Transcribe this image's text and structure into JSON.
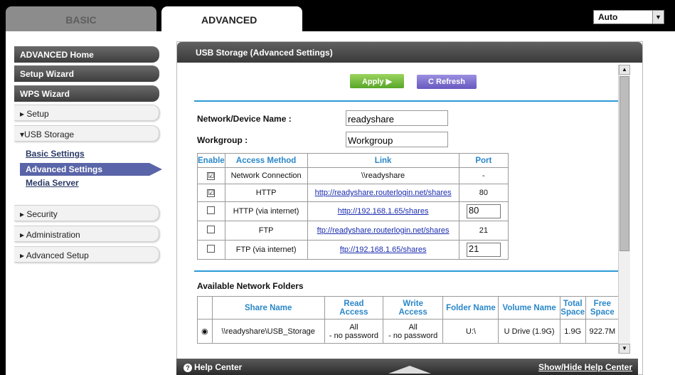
{
  "tabs": {
    "basic": "BASIC",
    "advanced": "ADVANCED"
  },
  "language": {
    "selected": "Auto"
  },
  "sidebar": {
    "advanced_home": "ADVANCED Home",
    "setup_wizard": "Setup Wizard",
    "wps_wizard": "WPS Wizard",
    "setup": "▸ Setup",
    "usb_storage": "▾USB Storage",
    "basic_settings": "Basic Settings",
    "advanced_settings": "Advanced Settings",
    "media_server": "Media Server",
    "security": "▸ Security",
    "administration": "▸ Administration",
    "advanced_setup": "▸ Advanced Setup"
  },
  "panel": {
    "title": "USB Storage (Advanced Settings)",
    "apply": "Apply ▶",
    "refresh": "C  Refresh",
    "device_name_label": "Network/Device Name :",
    "device_name_value": "readyshare",
    "workgroup_label": "Workgroup :",
    "workgroup_value": "Workgroup"
  },
  "access_table": {
    "headers": [
      "Enable",
      "Access Method",
      "Link",
      "Port"
    ],
    "rows": [
      {
        "enabled": "☑",
        "method": "Network Connection",
        "link": "\\\\readyshare",
        "port": "-"
      },
      {
        "enabled": "☑",
        "method": "HTTP",
        "link": "http://readyshare.routerlogin.net/shares",
        "port": "80"
      },
      {
        "enabled": "",
        "method": "HTTP (via internet)",
        "link": "http://192.168.1.65/shares",
        "port": "80"
      },
      {
        "enabled": "",
        "method": "FTP",
        "link": "ftp://readyshare.routerlogin.net/shares",
        "port": "21"
      },
      {
        "enabled": "",
        "method": "FTP (via internet)",
        "link": "ftp://192.168.1.65/shares",
        "port": "21"
      }
    ]
  },
  "folders": {
    "title": "Available Network Folders",
    "headers": {
      "share_name": "Share Name",
      "read_access_1": "Read",
      "read_access_2": "Access",
      "write_access_1": "Write",
      "write_access_2": "Access",
      "folder_name": "Folder Name",
      "volume_name": "Volume Name",
      "total_1": "Total",
      "total_2": "Space",
      "free_1": "Free",
      "free_2": "Space"
    },
    "row": {
      "radio": "◉",
      "share_name": "\\\\readyshare\\USB_Storage",
      "read_1": "All",
      "read_2": "- no password",
      "write_1": "All",
      "write_2": "- no password",
      "folder_name": "U:\\",
      "volume_name": "U Drive (1.9G)",
      "total": "1.9G",
      "free": "922.7M"
    }
  },
  "footer": {
    "help_center": "Help Center",
    "show_hide": "Show/Hide Help Center"
  }
}
